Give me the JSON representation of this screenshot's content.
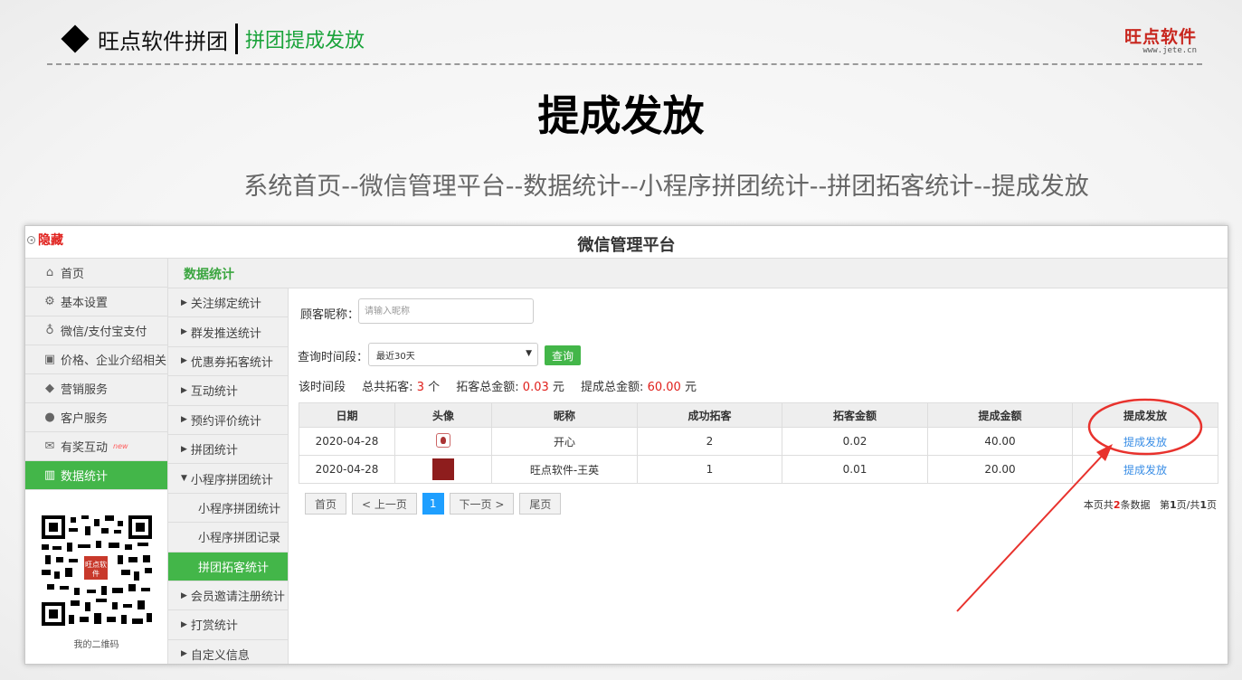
{
  "slide": {
    "header_title": "旺点软件拼团",
    "header_subtitle": "拼团提成发放",
    "brand_name": "旺点软件",
    "brand_url": "www.jete.cn",
    "main_title": "提成发放",
    "breadcrumb": "系统首页--微信管理平台--数据统计--小程序拼团统计--拼团拓客统计--提成发放"
  },
  "app": {
    "hide_label": "隐藏",
    "platform_title": "微信管理平台",
    "section_title": "数据统计",
    "nav": [
      {
        "label": "首页",
        "icon": "home-icon"
      },
      {
        "label": "基本设置",
        "icon": "gear-icon"
      },
      {
        "label": "微信/支付宝支付",
        "icon": "money-bag-icon"
      },
      {
        "label": "价格、企业介绍相关",
        "icon": "document-icon"
      },
      {
        "label": "营销服务",
        "icon": "tag-icon"
      },
      {
        "label": "客户服务",
        "icon": "user-icon"
      },
      {
        "label": "有奖互动",
        "icon": "gift-icon",
        "badge": "new"
      },
      {
        "label": "数据统计",
        "icon": "bar-chart-icon",
        "active": true
      }
    ],
    "qr_caption": "我的二维码",
    "qr_logo_text": "旺点软件",
    "subnav": [
      {
        "label": "关注绑定统计"
      },
      {
        "label": "群发推送统计"
      },
      {
        "label": "优惠券拓客统计"
      },
      {
        "label": "互动统计"
      },
      {
        "label": "预约评价统计"
      },
      {
        "label": "拼团统计"
      },
      {
        "label": "小程序拼团统计"
      },
      {
        "label": "小程序拼团统计"
      },
      {
        "label": "小程序拼团记录"
      },
      {
        "label": "拼团拓客统计"
      },
      {
        "label": "会员邀请注册统计"
      },
      {
        "label": "打赏统计"
      },
      {
        "label": "自定义信息"
      }
    ],
    "filter": {
      "nickname_label": "顾客昵称：",
      "nickname_placeholder": "请输入昵称",
      "period_label": "查询时间段：",
      "period_value": "最近30天",
      "query_button": "查询"
    },
    "summary": {
      "period_label": "该时间段",
      "total_customers_label": "总共拓客:",
      "total_customers_value": "3",
      "total_customers_unit": "个",
      "total_amount_label": "拓客总金额:",
      "total_amount_value": "0.03",
      "amount_unit": "元",
      "commission_label": "提成总金额:",
      "commission_value": "60.00",
      "commission_unit": "元"
    },
    "table": {
      "headers": [
        "日期",
        "头像",
        "昵称",
        "成功拓客",
        "拓客金额",
        "提成金额",
        "提成发放"
      ],
      "rows": [
        {
          "date": "2020-04-28",
          "avatar": "avatar-icon",
          "nickname": "开心",
          "success": "2",
          "amount": "0.02",
          "commission": "40.00",
          "action": "提成发放"
        },
        {
          "date": "2020-04-28",
          "avatar": "avatar-icon",
          "nickname": "旺点软件-王英",
          "success": "1",
          "amount": "0.01",
          "commission": "20.00",
          "action": "提成发放"
        }
      ]
    },
    "pager": {
      "first": "首页",
      "prev": "< 上一页",
      "current": "1",
      "next": "下一页 >",
      "last": "尾页",
      "info_prefix": "本页共",
      "info_count": "2",
      "info_suffix": "条数据",
      "info_page_prefix": "第",
      "info_page": "1",
      "info_page_mid": "页/共",
      "info_total_pages": "1",
      "info_page_suffix": "页"
    }
  },
  "colors": {
    "green": "#43b649",
    "red_annotation": "#e8322d",
    "link_blue": "#3a8ee6"
  }
}
